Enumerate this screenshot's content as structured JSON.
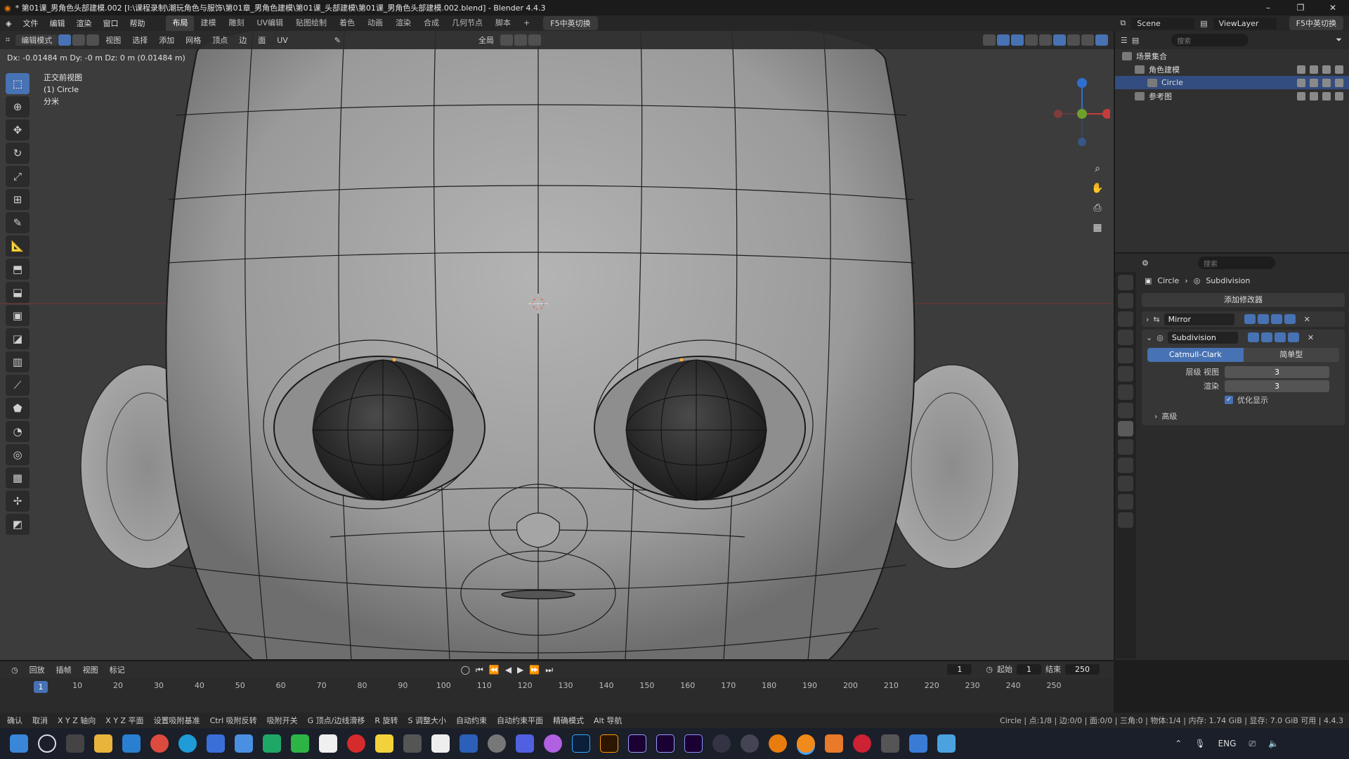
{
  "window": {
    "title": "* 第01课_男角色头部建模.002 [I:\\课程录制\\潮玩角色与服饰\\第01章_男角色建模\\第01课_头部建模\\第01课_男角色头部建模.002.blend] - Blender 4.4.3",
    "min": "–",
    "max": "❐",
    "close": "✕"
  },
  "menu": [
    "文件",
    "编辑",
    "渲染",
    "窗口",
    "帮助"
  ],
  "workspaces": [
    "布局",
    "建模",
    "雕刻",
    "UV编辑",
    "贴图绘制",
    "着色",
    "动画",
    "渲染",
    "合成",
    "几何节点",
    "脚本"
  ],
  "workspace_active": "布局",
  "ime_toggle": "F5中英切换",
  "scene": "Scene",
  "view_layer": "ViewLayer",
  "ime_toggle_right": "F5中英切换",
  "viewport_header": {
    "mode": "编辑模式",
    "menus": [
      "视图",
      "选择",
      "添加",
      "网格",
      "顶点",
      "边",
      "面",
      "UV"
    ],
    "transform_orient": "全局"
  },
  "dx_readout": "Dx: -0.01484 m  Dy: -0 m  Dz: 0 m (0.01484 m)",
  "view_info": {
    "view": "正交前视图",
    "object": "(1) Circle",
    "unit": "分米"
  },
  "tools": [
    "select-tool",
    "cursor-tool",
    "move-tool",
    "rotate-tool",
    "scale-tool",
    "transform-tool",
    "annotate-tool",
    "measure-tool",
    "add-cube-tool",
    "extrude-tool",
    "inset-tool",
    "bevel-tool",
    "loopcut-tool",
    "knife-tool",
    "polybuild-tool",
    "spin-tool",
    "smooth-tool",
    "shrink-tool",
    "shear-tool",
    "rip-tool"
  ],
  "outliner": {
    "search_placeholder": "搜索",
    "rows": [
      {
        "label": "场景集合",
        "indent": 0
      },
      {
        "label": "角色建模",
        "indent": 1
      },
      {
        "label": "Circle",
        "indent": 2,
        "selected": true
      },
      {
        "label": "参考图",
        "indent": 1
      }
    ]
  },
  "properties": {
    "search_placeholder": "搜索",
    "breadcrumb_object": "Circle",
    "breadcrumb_modifier": "Subdivision",
    "add_modifier": "添加修改器",
    "modifiers": [
      {
        "name": "Mirror",
        "expanded": false
      },
      {
        "name": "Subdivision",
        "expanded": true
      }
    ],
    "subdiv_types": [
      "Catmull-Clark",
      "简单型"
    ],
    "levels_viewport_label": "层级 视图",
    "levels_viewport": "3",
    "render_label": "渲染",
    "render_levels": "3",
    "optimal_display": "优化显示",
    "advanced": "高级"
  },
  "timeline": {
    "menus": [
      "回放",
      "插帧",
      "视图",
      "标记"
    ],
    "current_frame": "1",
    "start_label": "起始",
    "start": "1",
    "end_label": "结束",
    "end": "250",
    "ruler": [
      "1",
      "10",
      "20",
      "30",
      "40",
      "50",
      "60",
      "70",
      "80",
      "90",
      "100",
      "110",
      "120",
      "130",
      "140",
      "150",
      "160",
      "170",
      "180",
      "190",
      "200",
      "210",
      "220",
      "230",
      "240",
      "250"
    ]
  },
  "statusbar": {
    "items": [
      "确认",
      "取消",
      "X Y Z 轴向",
      "X Y Z 平面",
      "设置吸附基准",
      "Ctrl 吸附反转",
      "吸附开关",
      "G 顶点/边线滑移",
      "R 旋转",
      "S 调整大小",
      "自动约束",
      "自动约束平面",
      "精确模式",
      "Alt 导航"
    ],
    "right": "Circle | 点:1/8 | 边:0/0 | 面:0/0 | 三角:0 | 物体:1/4 | 内存: 1.74 GiB | 显存: 7.0 GiB 可用 | 4.4.3"
  },
  "taskbar": {
    "lang": "ENG"
  },
  "colors": {
    "accent": "#4772b3",
    "viewport_bg": "#3c3c3c",
    "panel": "#2b2b2b"
  }
}
